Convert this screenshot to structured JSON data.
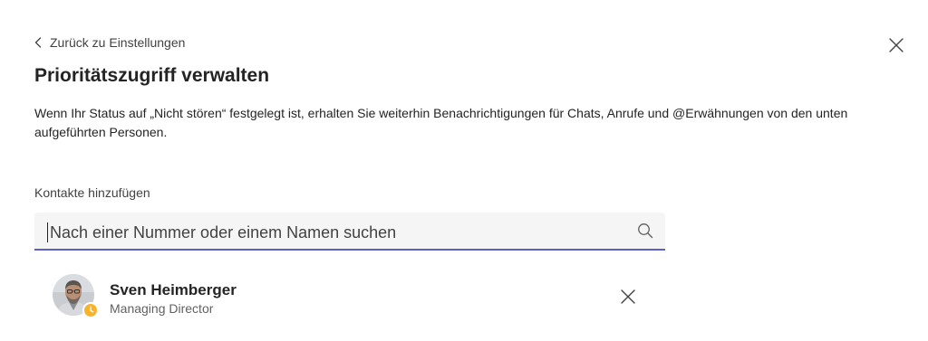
{
  "header": {
    "back_label": "Zurück zu Einstellungen",
    "title": "Prioritätszugriff verwalten",
    "description": "Wenn Ihr Status auf „Nicht stören“ festgelegt ist, erhalten Sie weiterhin Benachrichtigungen für Chats, Anrufe und @Erwähnungen von den unten aufgeführten Personen."
  },
  "icons": {
    "back": "chevron-left-icon",
    "close": "close-icon",
    "search": "search-icon",
    "remove": "close-icon"
  },
  "add_contacts": {
    "label": "Kontakte hinzufügen",
    "search_value": "",
    "search_placeholder": "Nach einer Nummer oder einem Namen suchen"
  },
  "contacts": [
    {
      "name": "Sven Heimberger",
      "role": "Managing Director",
      "status": "away",
      "status_color": "#f8b32c"
    }
  ],
  "colors": {
    "accent": "#5b5fc7",
    "away": "#f8b32c",
    "text_primary": "#242424",
    "text_secondary": "#616161"
  }
}
